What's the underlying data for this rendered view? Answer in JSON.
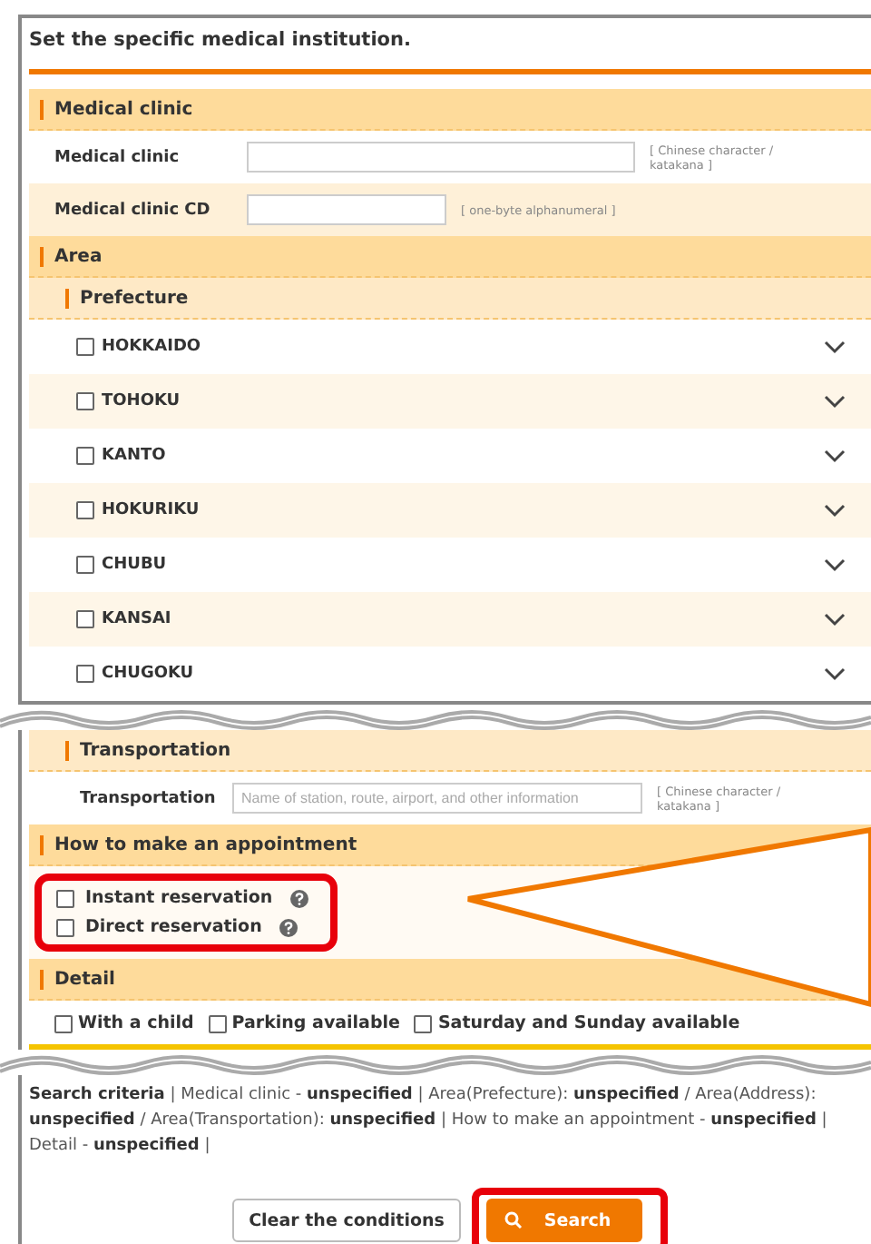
{
  "title": "Set the specific medical institution.",
  "medical_clinic": {
    "heading": "Medical clinic",
    "fields": [
      {
        "label": "Medical clinic",
        "note": "[ Chinese character / katakana ]"
      },
      {
        "label": "Medical clinic CD",
        "note": "[ one-byte alphanumeral ]"
      }
    ]
  },
  "area": {
    "heading": "Area",
    "prefecture": {
      "heading": "Prefecture",
      "regions": [
        {
          "label": "HOKKAIDO",
          "checked": false
        },
        {
          "label": "TOHOKU",
          "checked": false
        },
        {
          "label": "KANTO",
          "checked": false
        },
        {
          "label": "HOKURIKU",
          "checked": false
        },
        {
          "label": "CHUBU",
          "checked": false
        },
        {
          "label": "KANSAI",
          "checked": false
        },
        {
          "label": "CHUGOKU",
          "checked": false
        }
      ]
    },
    "transportation": {
      "heading": "Transportation",
      "label": "Transportation",
      "placeholder": "Name of station, route, airport, and other information",
      "note": "[ Chinese character / katakana ]"
    }
  },
  "appointment": {
    "heading": "How to make an appointment",
    "options": [
      {
        "label": "Instant reservation",
        "checked": false
      },
      {
        "label": "Direct reservation",
        "checked": false
      }
    ]
  },
  "detail": {
    "heading": "Detail",
    "options": [
      {
        "label": "With a child",
        "checked": false
      },
      {
        "label": "Parking available",
        "checked": false
      },
      {
        "label": "Saturday and Sunday available",
        "checked": false
      }
    ]
  },
  "search_criteria": {
    "text": "**Search criteria**  |  Medical clinic - **unspecified**  |  Area(Prefecture): **unspecified** / Area(Address): **unspecified** / Area(Transportation): **unspecified**  |  How to make an appointment - **unspecified**  |  Detail - **unspecified**  |"
  },
  "buttons": [
    {
      "label": "Clear the conditions",
      "kind": "secondary"
    },
    {
      "label": "Search",
      "kind": "primary"
    }
  ]
}
